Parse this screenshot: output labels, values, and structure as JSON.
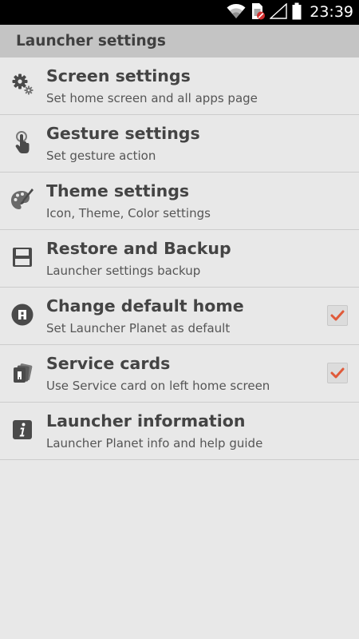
{
  "status_bar": {
    "time": "23:39",
    "icons": [
      "wifi-icon",
      "sim-card-no-service-icon",
      "signal-icon",
      "battery-icon"
    ]
  },
  "header": {
    "title": "Launcher settings"
  },
  "settings": [
    {
      "icon": "gear-icon",
      "title": "Screen settings",
      "subtitle": "Set home screen and all apps page",
      "checked": null
    },
    {
      "icon": "hand-touch-icon",
      "title": "Gesture settings",
      "subtitle": "Set gesture action",
      "checked": null
    },
    {
      "icon": "palette-brush-icon",
      "title": "Theme settings",
      "subtitle": "Icon, Theme, Color settings",
      "checked": null
    },
    {
      "icon": "floppy-disk-icon",
      "title": "Restore and Backup",
      "subtitle": "Launcher settings backup",
      "checked": null
    },
    {
      "icon": "launcher-home-icon",
      "title": "Change default home",
      "subtitle": "Set Launcher Planet as default",
      "checked": true
    },
    {
      "icon": "service-cards-icon",
      "title": "Service cards",
      "subtitle": "Use Service card on left home screen",
      "checked": true
    },
    {
      "icon": "info-icon",
      "title": "Launcher information",
      "subtitle": "Launcher Planet info and help guide",
      "checked": null
    }
  ],
  "colors": {
    "background": "#e8e8e8",
    "header": "#c4c4c4",
    "icon": "#4a4a4a",
    "checkmark": "#e05a3a"
  }
}
